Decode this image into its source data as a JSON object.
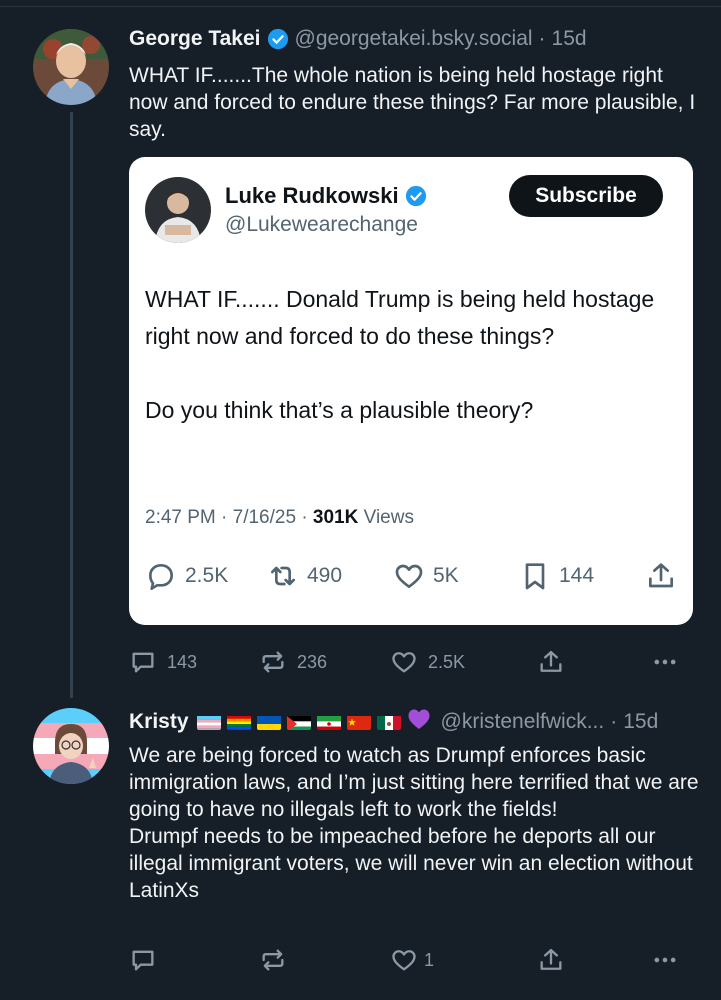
{
  "post1": {
    "display_name": "George Takei",
    "handle": "@georgetakei.bsky.social",
    "time": "15d",
    "text": "WHAT IF.......The whole nation is being held hostage right now and forced to endure these things? Far more plausible, I say.",
    "embed": {
      "display_name": "Luke Rudkowski",
      "handle": "@Lukewearechange",
      "subscribe_label": "Subscribe",
      "text": "WHAT IF....... Donald Trump is being held hostage right now and forced to do these things?\n\nDo you think that’s a plausible theory?",
      "timestamp": "2:47 PM · 7/16/25 · ",
      "views_count": "301K",
      "views_label": " Views",
      "replies": "2.5K",
      "reposts": "490",
      "likes": "5K",
      "bookmarks": "144"
    },
    "replies": "143",
    "reposts": "236",
    "likes": "2.5K"
  },
  "post2": {
    "display_name": "Kristy",
    "handle": "@kristenelfwick...",
    "time": "15d",
    "text": "We are being forced to watch as Drumpf enforces basic immigration laws, and I’m just sitting here terrified that we are going to have no illegals left to work the fields!\nDrumpf needs to be impeached before he deports all our illegal immigrant voters, we will never win an election without LatinXs",
    "likes": "1",
    "flags": [
      "trans-flag",
      "rainbow-flag",
      "ukraine-flag",
      "palestine-flag",
      "iran-flag",
      "china-flag",
      "mexico-flag",
      "purple-heart"
    ]
  },
  "colors": {
    "background": "#161e27",
    "accent": "#1d9bf0",
    "muted": "#8b98a5"
  }
}
